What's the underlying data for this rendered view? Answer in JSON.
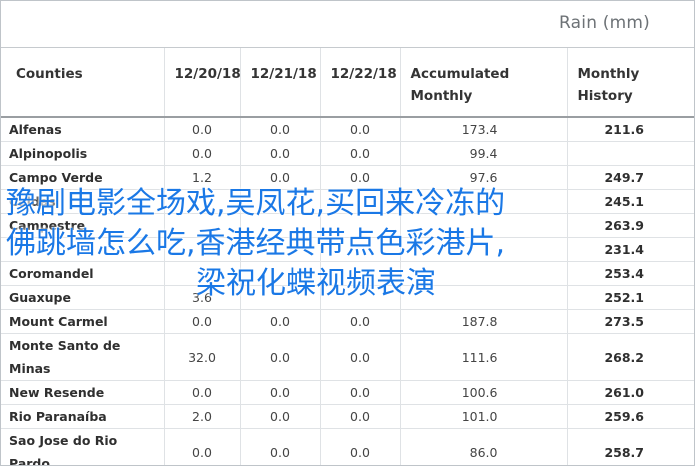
{
  "unit_label": "Rain (mm)",
  "columns": [
    "Counties",
    "12/20/18",
    "12/21/18",
    "12/22/18",
    "Accumulated Monthly",
    "Monthly History"
  ],
  "rows": [
    {
      "county": "Alfenas",
      "d1": "0.0",
      "d2": "0.0",
      "d3": "0.0",
      "acc": "173.4",
      "hist": "211.6"
    },
    {
      "county": "Alpinopolis",
      "d1": "0.0",
      "d2": "0.0",
      "d3": "0.0",
      "acc": "99.4",
      "hist": ""
    },
    {
      "county": "Campo Verde",
      "d1": "1.2",
      "d2": "0.0",
      "d3": "0.0",
      "acc": "97.6",
      "hist": "249.7"
    },
    {
      "county": "Caldas",
      "d1": "",
      "d2": "",
      "d3": "",
      "acc": "",
      "hist": "245.1"
    },
    {
      "county": "Campestre",
      "d1": "",
      "d2": "",
      "d3": "",
      "acc": "",
      "hist": "263.9"
    },
    {
      "county": "",
      "d1": "",
      "d2": "",
      "d3": "",
      "acc": "",
      "hist": "231.4"
    },
    {
      "county": "Coromandel",
      "d1": "",
      "d2": "",
      "d3": "",
      "acc": "",
      "hist": "253.4"
    },
    {
      "county": "Guaxupe",
      "d1": "3.6",
      "d2": "",
      "d3": "",
      "acc": "",
      "hist": "252.1"
    },
    {
      "county": "Mount Carmel",
      "d1": "0.0",
      "d2": "0.0",
      "d3": "0.0",
      "acc": "187.8",
      "hist": "273.5"
    },
    {
      "county": "Monte Santo de Minas",
      "d1": "32.0",
      "d2": "0.0",
      "d3": "0.0",
      "acc": "111.6",
      "hist": "268.2"
    },
    {
      "county": "New Resende",
      "d1": "0.0",
      "d2": "0.0",
      "d3": "0.0",
      "acc": "100.6",
      "hist": "261.0"
    },
    {
      "county": "Rio Paranaíba",
      "d1": "2.0",
      "d2": "0.0",
      "d3": "0.0",
      "acc": "101.0",
      "hist": "259.6"
    },
    {
      "county": "Sao Jose do Rio Pardo",
      "d1": "0.0",
      "d2": "0.0",
      "d3": "0.0",
      "acc": "86.0",
      "hist": "258.7"
    }
  ],
  "overlay": {
    "line1": "豫剧电影全场戏,吴凤花,买回来冷冻的",
    "line2": "佛跳墙怎么吃,香港经典带点色彩港片,",
    "line3": "梁祝化蝶视频表演"
  },
  "colors": {
    "overlay_text": "#1a78e6",
    "header_text": "#343434",
    "unit_text": "#6d7276"
  }
}
